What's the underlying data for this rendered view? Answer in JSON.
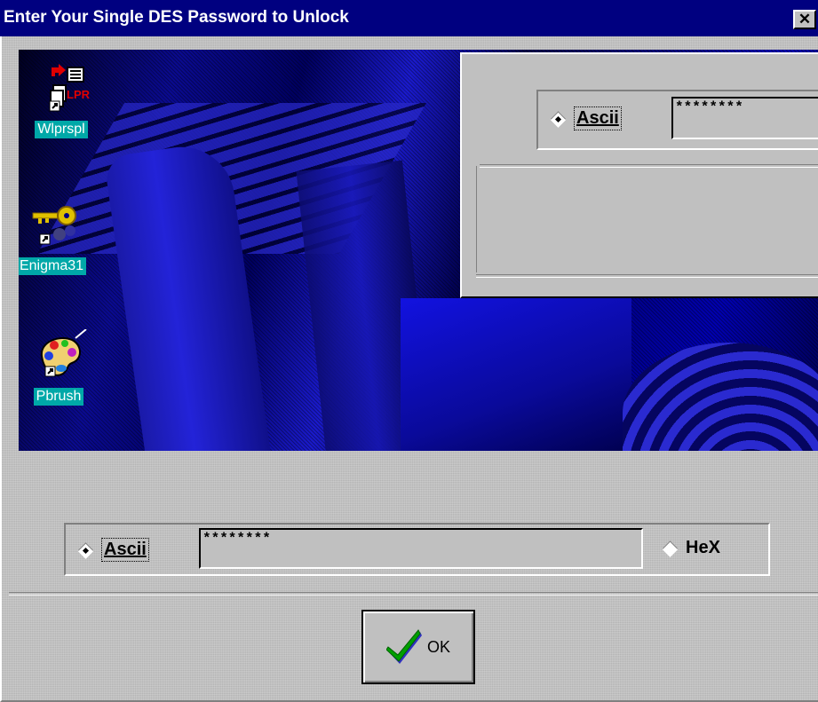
{
  "window": {
    "title": "Enter Your Single DES Password to Unlock",
    "close_glyph": "✕"
  },
  "desktop": {
    "icons": [
      {
        "label": "Wlprspl",
        "icon": "printer-lpr-icon"
      },
      {
        "label": "Enigma31",
        "icon": "key-icon"
      },
      {
        "label": "Pbrush",
        "icon": "paint-palette-icon"
      }
    ],
    "lpr_text": "LPR"
  },
  "preview_panel": {
    "ascii_label": "Ascii",
    "password_value": "********"
  },
  "password_row": {
    "ascii_label": "Ascii",
    "password_value": "********",
    "hex_label": "HeX",
    "selected_mode": "Ascii"
  },
  "ok_button": {
    "label": "OK",
    "icon": "checkmark-icon"
  },
  "colors": {
    "titlebar": "#000080",
    "dialog_face": "#c0c0c0",
    "desktop_label_bg": "#00a8a8",
    "checkmark_green": "#00a000",
    "checkmark_blue": "#3030c0"
  }
}
